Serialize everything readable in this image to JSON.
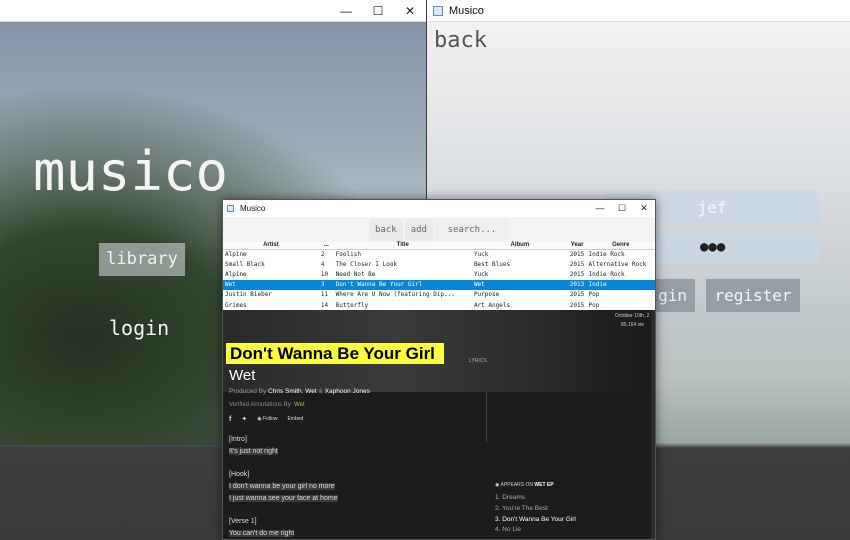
{
  "win_left": {
    "title": "",
    "title_text": "musico",
    "library_label": "library",
    "login_label": "login"
  },
  "win_right": {
    "title": "Musico",
    "back_label": "back",
    "username": "jef",
    "password": "●●●",
    "login_label": "gin",
    "register_label": "register"
  },
  "win_main": {
    "title": "Musico",
    "toolbar": {
      "back": "back",
      "add": "add",
      "search_placeholder": "search..."
    },
    "columns": [
      "Artist",
      "...",
      "Title",
      "Album",
      "Year",
      "Genre"
    ],
    "rows": [
      [
        "Alpine",
        "2",
        "Foolish",
        "Yuck",
        "2015",
        "Indie Rock"
      ],
      [
        "Small Black",
        "4",
        "The Closer I Look",
        "Best Blues",
        "2015",
        "Alternative Rock"
      ],
      [
        "Alpine",
        "10",
        "Need Not Be",
        "Yuck",
        "2015",
        "Indie Rock"
      ],
      [
        "Wet",
        "3",
        "Don't Wanna Be Your Girl",
        "Wet",
        "2013",
        "Indie"
      ],
      [
        "Justin Bieber",
        "11",
        "Where Are U Now (featuring Dip...",
        "Purpose",
        "2015",
        "Pop"
      ],
      [
        "Grimes",
        "14",
        "Butterfly",
        "Art Angels",
        "2015",
        "Pop"
      ]
    ],
    "selected_row": 3,
    "lyrics": {
      "date": "October 10th, 2",
      "views": "85,164 vie",
      "song_title": "Don't Wanna Be Your Girl",
      "lyrics_label": "LYRICS",
      "artist": "Wet",
      "produced_by_label": "Produced By",
      "producer1": "Chris Smith",
      "producer2": "Wet",
      "producer3": "Xaphoon Jones",
      "verified_label": "Verified Annotations By",
      "verified_by": "Wet",
      "follow_label": "Follow",
      "embed_label": "Embed",
      "lines": [
        "[Intro]",
        "It's just not right",
        "",
        "[Hook]",
        "I don't wanna be your girl no more",
        "I just wanna see your face at home",
        "",
        "[Verse 1]",
        "You can't do me right"
      ],
      "appears_on_label": "APPEARS ON",
      "appears_on_album": "WET EP",
      "tracks": [
        "1. Dreams",
        "2. You're The Best",
        "3. Don't Wanna Be Your Girl",
        "4. No Lie"
      ]
    }
  }
}
